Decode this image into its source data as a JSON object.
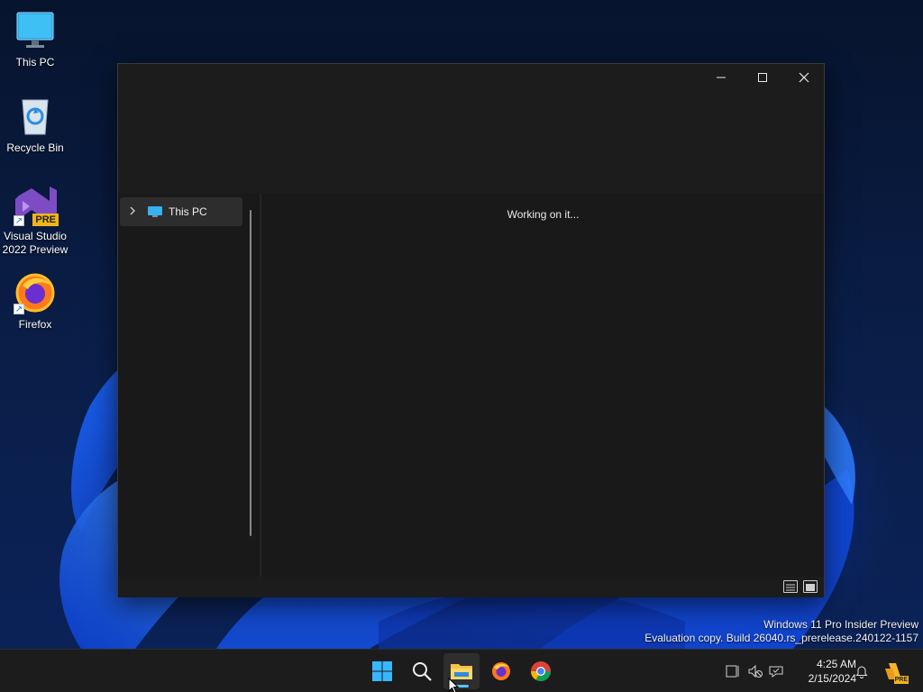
{
  "desktop": {
    "icons": [
      {
        "label": "This PC",
        "icon": "monitor-icon"
      },
      {
        "label": "Recycle Bin",
        "icon": "recycle-bin-icon"
      },
      {
        "label": "Visual Studio 2022 Preview",
        "icon": "visual-studio-icon",
        "badge": "PRE"
      },
      {
        "label": "Firefox",
        "icon": "firefox-icon"
      }
    ]
  },
  "window": {
    "controls": {
      "minimize": "minimize-icon",
      "maximize": "maximize-icon",
      "close": "close-icon"
    },
    "nav": {
      "items": [
        {
          "label": "This PC",
          "icon": "monitor-icon",
          "expand_icon": "chevron-right-icon"
        }
      ]
    },
    "content": {
      "status_text": "Working on it..."
    },
    "statusbar": {
      "views": [
        "details-view-icon",
        "large-icons-view-icon"
      ]
    }
  },
  "watermark": {
    "line1": "Windows 11 Pro Insider Preview",
    "line2": "Evaluation copy. Build 26040.rs_prerelease.240122-1157"
  },
  "taskbar": {
    "apps": [
      {
        "name": "Start",
        "icon": "windows-start-icon"
      },
      {
        "name": "Search",
        "icon": "search-icon"
      },
      {
        "name": "File Explorer",
        "icon": "file-explorer-icon",
        "active": true
      },
      {
        "name": "Firefox",
        "icon": "firefox-icon"
      },
      {
        "name": "Chrome",
        "icon": "chrome-icon"
      }
    ],
    "tray": {
      "icons": [
        "network-icon",
        "volume-muted-icon",
        "language-icon"
      ],
      "time": "4:25 AM",
      "date": "2/15/2024",
      "notification_icon": "bell-icon",
      "copilot_badge": "PRE"
    }
  },
  "colors": {
    "accent": "#5ec0ff",
    "window_bg": "#1c1c1c",
    "taskbar_bg": "#1c1c1c"
  }
}
